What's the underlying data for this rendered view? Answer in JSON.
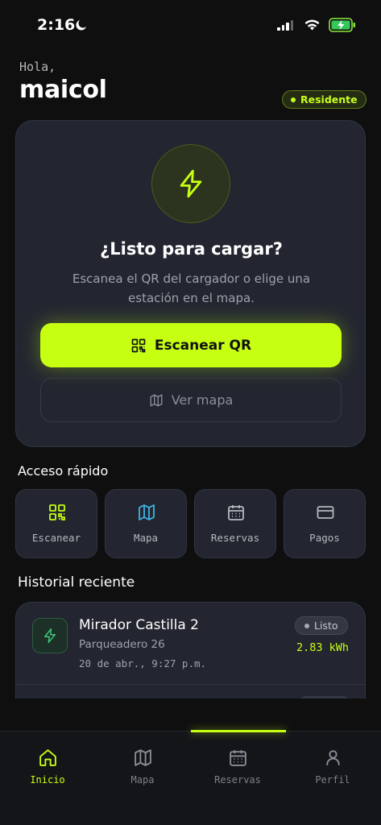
{
  "status_bar": {
    "time": "2:16"
  },
  "greeting": {
    "hello": "Hola,",
    "name": "maicol",
    "badge": "Residente"
  },
  "hero": {
    "title": "¿Listo para cargar?",
    "subtitle": "Escanea el QR del cargador o elige una estación en el mapa.",
    "scan_button": "Escanear QR",
    "map_button": "Ver mapa"
  },
  "quick_access": {
    "title": "Acceso rápido",
    "items": [
      {
        "label": "Escanear",
        "icon": "qr-icon",
        "color": "#c6ff12"
      },
      {
        "label": "Mapa",
        "icon": "map-icon",
        "color": "#3bb6e8"
      },
      {
        "label": "Reservas",
        "icon": "calendar-icon",
        "color": "#b6b8c0"
      },
      {
        "label": "Pagos",
        "icon": "card-icon",
        "color": "#b6b8c0"
      }
    ]
  },
  "history": {
    "title": "Historial reciente",
    "items": [
      {
        "station": "Mirador Castilla 2",
        "location": "Parqueadero 26",
        "date": "20 de abr., 9:27 p.m.",
        "status": "Listo",
        "energy": "2.83 kWh"
      }
    ]
  },
  "nav": {
    "items": [
      {
        "label": "Inicio",
        "icon": "home-icon",
        "active": true
      },
      {
        "label": "Mapa",
        "icon": "map-icon"
      },
      {
        "label": "Reservas",
        "icon": "calendar-icon"
      },
      {
        "label": "Perfil",
        "icon": "user-icon"
      }
    ]
  },
  "colors": {
    "accent": "#c6ff12",
    "background": "#0f0f10",
    "card": "#232630"
  }
}
